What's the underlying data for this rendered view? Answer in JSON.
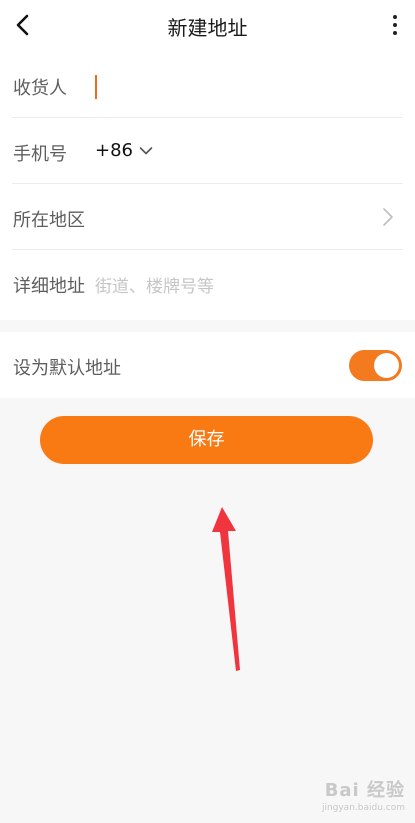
{
  "header": {
    "title": "新建地址",
    "back_icon": "chevron-left-icon",
    "more_icon": "more-vertical-icon"
  },
  "form": {
    "recipient": {
      "label": "收货人",
      "value": ""
    },
    "phone": {
      "label": "手机号",
      "country_code": "+86",
      "value": ""
    },
    "region": {
      "label": "所在地区",
      "value": ""
    },
    "detail": {
      "label": "详细地址",
      "placeholder": "街道、楼牌号等"
    }
  },
  "default_setting": {
    "label": "设为默认地址",
    "enabled": true
  },
  "save_button": {
    "label": "保存"
  },
  "colors": {
    "accent": "#f97a13",
    "toggle_on": "#f37a1f",
    "cursor": "#ef6a1d",
    "annotation_arrow": "#f0353f"
  },
  "watermark": {
    "main": "Bai 经验",
    "sub": "jingyan.baidu.com"
  }
}
